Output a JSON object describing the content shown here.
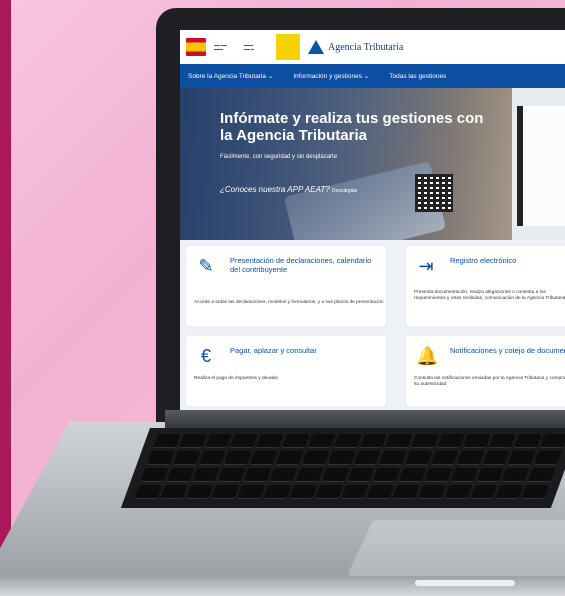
{
  "site": {
    "brand_name": "Agencia Tributaria",
    "nav": [
      {
        "label": "Sobre la Agencia Tributaria ⌄"
      },
      {
        "label": "Información y gestiones ⌄"
      },
      {
        "label": "Todas las gestiones"
      }
    ]
  },
  "hero": {
    "title": "Infórmate y realiza tus gestiones con la Agencia Tributaria",
    "subtitle": "Fácilmente, con seguridad y sin desplazarte",
    "app_prompt": "¿Conoces nuestra APP AEAT?",
    "app_cta": "Descárgala"
  },
  "cards": [
    {
      "icon": "pencil-edit-icon",
      "title": "Presentación de declaraciones, calendario del contribuyente",
      "desc": "Accede a todas las declaraciones, modelos y formularios, y a sus plazos de presentación"
    },
    {
      "icon": "door-enter-icon",
      "title": "Registro electrónico",
      "desc": "Presenta documentación, realiza alegaciones o contesta a los requerimientos y otras recibidas, comunicación de la Agencia Tributaria"
    },
    {
      "icon": "euro-icon",
      "title": "Pagar, aplazar y consultar",
      "desc": "Realiza el pago de impuestos y deudas"
    },
    {
      "icon": "bell-icon",
      "title": "Notificaciones y cotejo de documentos",
      "desc": "Consulta las notificaciones enviadas por la Agencia Tributaria y comprueba su autenticidad"
    }
  ],
  "colors": {
    "accent": "#0b4ea2",
    "background": "#f4bcd8",
    "stripe": "#a8185b"
  }
}
